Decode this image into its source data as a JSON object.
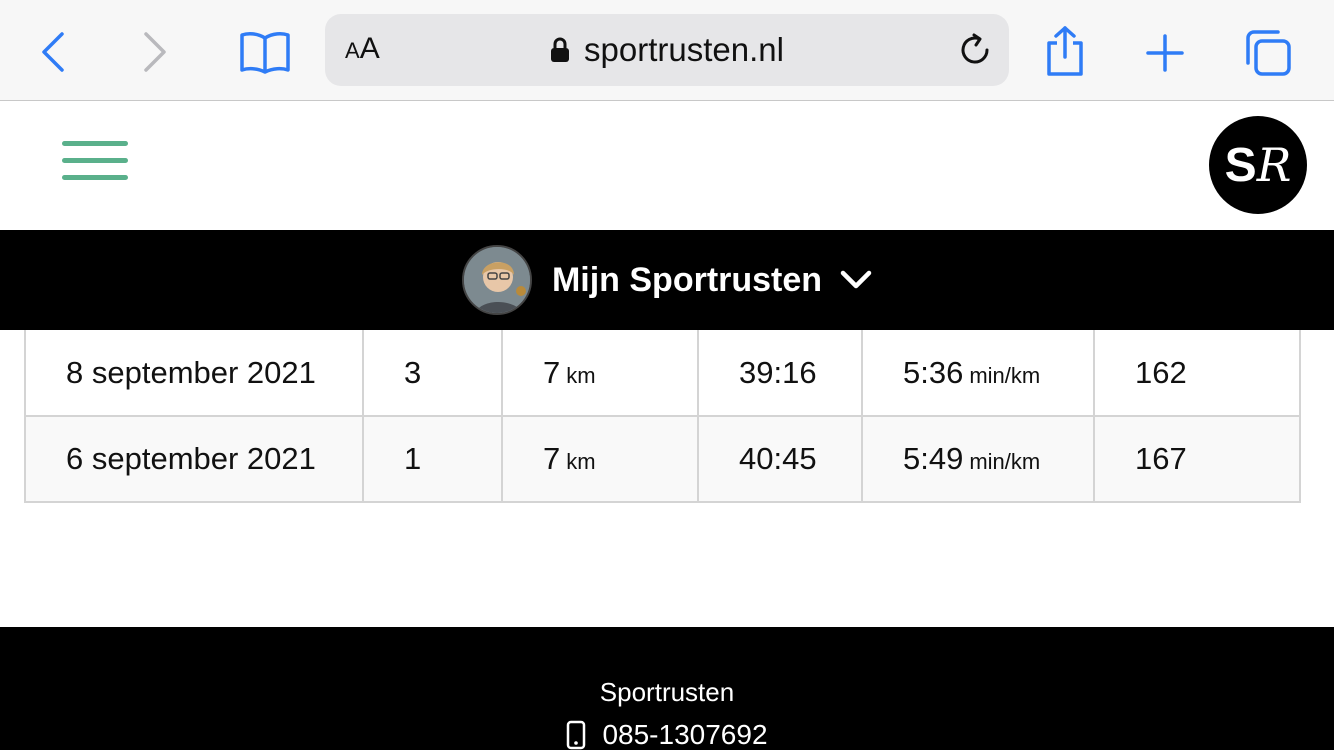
{
  "browser": {
    "url": "sportrusten.nl",
    "text_size_small": "A",
    "text_size_large": "A",
    "accent_color": "#2f7cf6"
  },
  "site": {
    "logo_s": "S",
    "logo_r": "R",
    "menu_color": "#5ab08b"
  },
  "account": {
    "label": "Mijn Sportrusten"
  },
  "table": {
    "rows": [
      {
        "date": "8 september 2021",
        "num": "3",
        "distance": "7",
        "distance_unit": "km",
        "time": "39:16",
        "pace": "5:36",
        "pace_unit": "min/km",
        "hr": "162"
      },
      {
        "date": "6 september 2021",
        "num": "1",
        "distance": "7",
        "distance_unit": "km",
        "time": "40:45",
        "pace": "5:49",
        "pace_unit": "min/km",
        "hr": "167"
      }
    ]
  },
  "footer": {
    "name": "Sportrusten",
    "phone": "085-1307692"
  }
}
